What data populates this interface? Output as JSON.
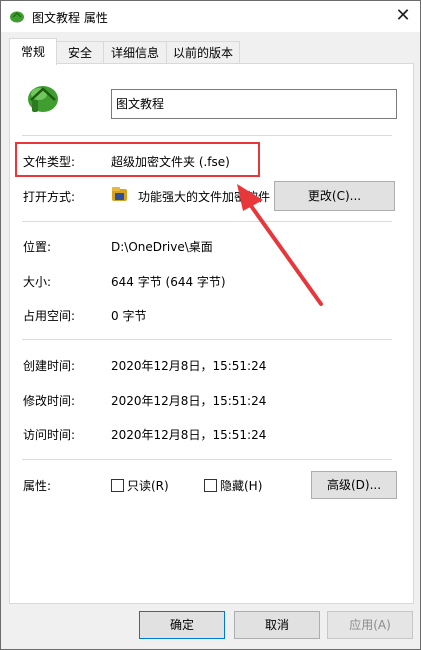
{
  "window": {
    "title": "图文教程 属性",
    "close_glyph": "✕"
  },
  "tabs": [
    "常规",
    "安全",
    "详细信息",
    "以前的版本"
  ],
  "general": {
    "file_name": "图文教程",
    "file_type_label": "文件类型:",
    "file_type_value": "超级加密文件夹 (.fse)",
    "open_with_label": "打开方式:",
    "open_with_value": "功能强大的文件加密软件",
    "change_button": "更改(C)...",
    "location_label": "位置:",
    "location_value": "D:\\OneDrive\\桌面",
    "size_label": "大小:",
    "size_value": "644 字节 (644 字节)",
    "disk_size_label": "占用空间:",
    "disk_size_value": "0 字节",
    "created_label": "创建时间:",
    "created_value": "2020年12月8日，15:51:24",
    "modified_label": "修改时间:",
    "modified_value": "2020年12月8日，15:51:24",
    "accessed_label": "访问时间:",
    "accessed_value": "2020年12月8日，15:51:24",
    "attributes_label": "属性:",
    "readonly_label": "只读(R)",
    "hidden_label": "隐藏(H)",
    "advanced_button": "高级(D)..."
  },
  "footer": {
    "ok": "确定",
    "cancel": "取消",
    "apply": "应用(A)"
  },
  "colors": {
    "annotation_red": "#e8373a",
    "title_icon_green": "#3f9e2f"
  }
}
